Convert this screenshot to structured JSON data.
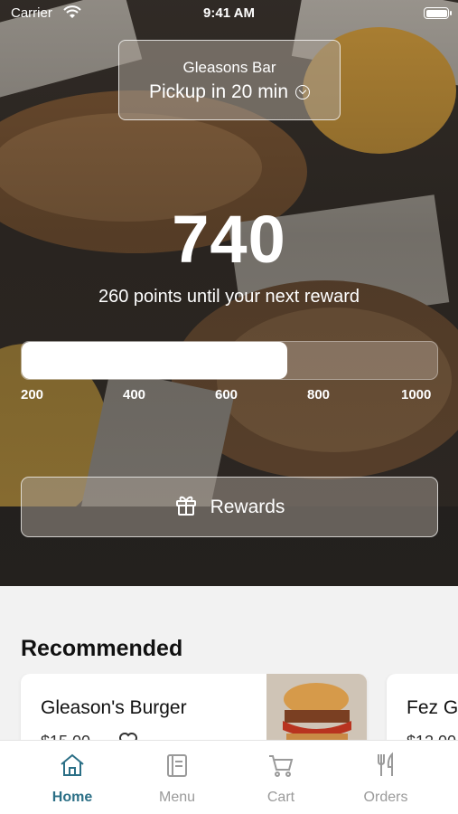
{
  "status_bar": {
    "carrier": "Carrier",
    "time": "9:41 AM"
  },
  "pickup": {
    "store": "Gleasons Bar",
    "time_label": "Pickup in 20 min"
  },
  "rewards": {
    "points": "740",
    "subtitle": "260 points until your next reward",
    "progress_fraction": 0.64,
    "ticks": [
      "200",
      "400",
      "600",
      "800",
      "1000"
    ],
    "button_label": "Rewards"
  },
  "recommended": {
    "title": "Recommended",
    "items": [
      {
        "name": "Gleason's Burger",
        "price": "$15.00"
      },
      {
        "name": "Fez G",
        "price": "$12.00"
      }
    ]
  },
  "tabs": [
    {
      "label": "Home",
      "icon": "home-icon",
      "active": true
    },
    {
      "label": "Menu",
      "icon": "menu-book-icon",
      "active": false
    },
    {
      "label": "Cart",
      "icon": "cart-icon",
      "active": false
    },
    {
      "label": "Orders",
      "icon": "fork-knife-icon",
      "active": false
    }
  ],
  "colors": {
    "accent": "#2b6f86",
    "tab_inactive": "#9a9a9a"
  }
}
